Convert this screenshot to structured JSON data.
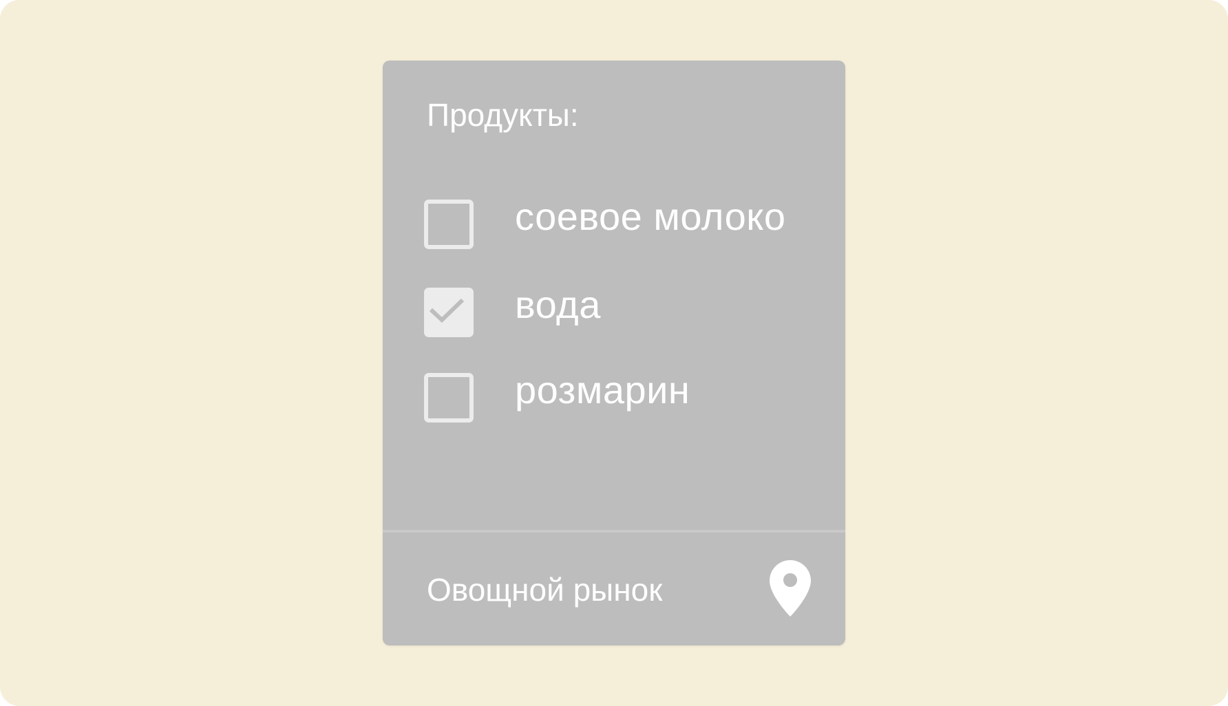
{
  "colors": {
    "background": "#f5eed9",
    "card": "#bdbdbd",
    "text": "#ffffff",
    "checkbox": "#ececec",
    "divider": "#c9c9c9"
  },
  "card": {
    "title": "Продукты:",
    "items": [
      {
        "label": "соевое молоко",
        "checked": false
      },
      {
        "label": "вода",
        "checked": true
      },
      {
        "label": "розмарин",
        "checked": false
      }
    ],
    "footer": {
      "location": "Овощной рынок",
      "icon": "location-pin-icon"
    }
  }
}
